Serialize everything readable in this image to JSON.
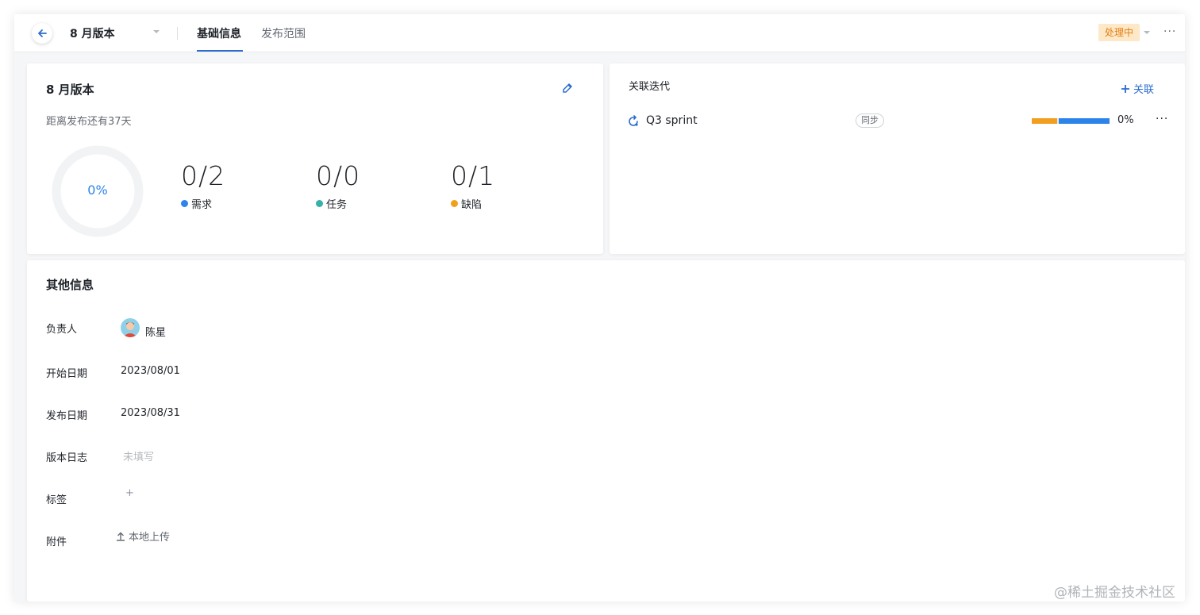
{
  "header": {
    "title": "8 月版本",
    "tabs": [
      {
        "label": "基础信息",
        "active": true
      },
      {
        "label": "发布范围",
        "active": false
      }
    ],
    "status": "处理中",
    "more": "···"
  },
  "overview": {
    "title": "8 月版本",
    "subtitle": "距离发布还有37天",
    "progress_label": "0%",
    "progress_fraction": 0,
    "stats": [
      {
        "value": "0/2",
        "label": "需求",
        "color": "#2c84e8"
      },
      {
        "value": "0/0",
        "label": "任务",
        "color": "#36b1a8"
      },
      {
        "value": "0/1",
        "label": "缺陷",
        "color": "#f29e1e"
      }
    ],
    "edit_icon": "pencil-icon"
  },
  "iterations": {
    "title": "关联迭代",
    "link_label": "关联",
    "items": [
      {
        "name": "Q3 sprint",
        "sync_label": "同步",
        "progress_label": "0%",
        "more": "···"
      }
    ]
  },
  "other": {
    "title": "其他信息",
    "fields": {
      "owner_label": "负责人",
      "owner_value": "陈星",
      "start_label": "开始日期",
      "start_value": "2023/08/01",
      "release_label": "发布日期",
      "release_value": "2023/08/31",
      "log_label": "版本日志",
      "log_placeholder": "未填写",
      "tags_label": "标签",
      "tags_add": "+",
      "attach_label": "附件",
      "attach_action": "本地上传"
    }
  },
  "watermark": "@稀土掘金技术社区",
  "colors": {
    "accent": "#2c6ccf",
    "status_bg": "#fde8c8",
    "status_fg": "#e57e12"
  }
}
